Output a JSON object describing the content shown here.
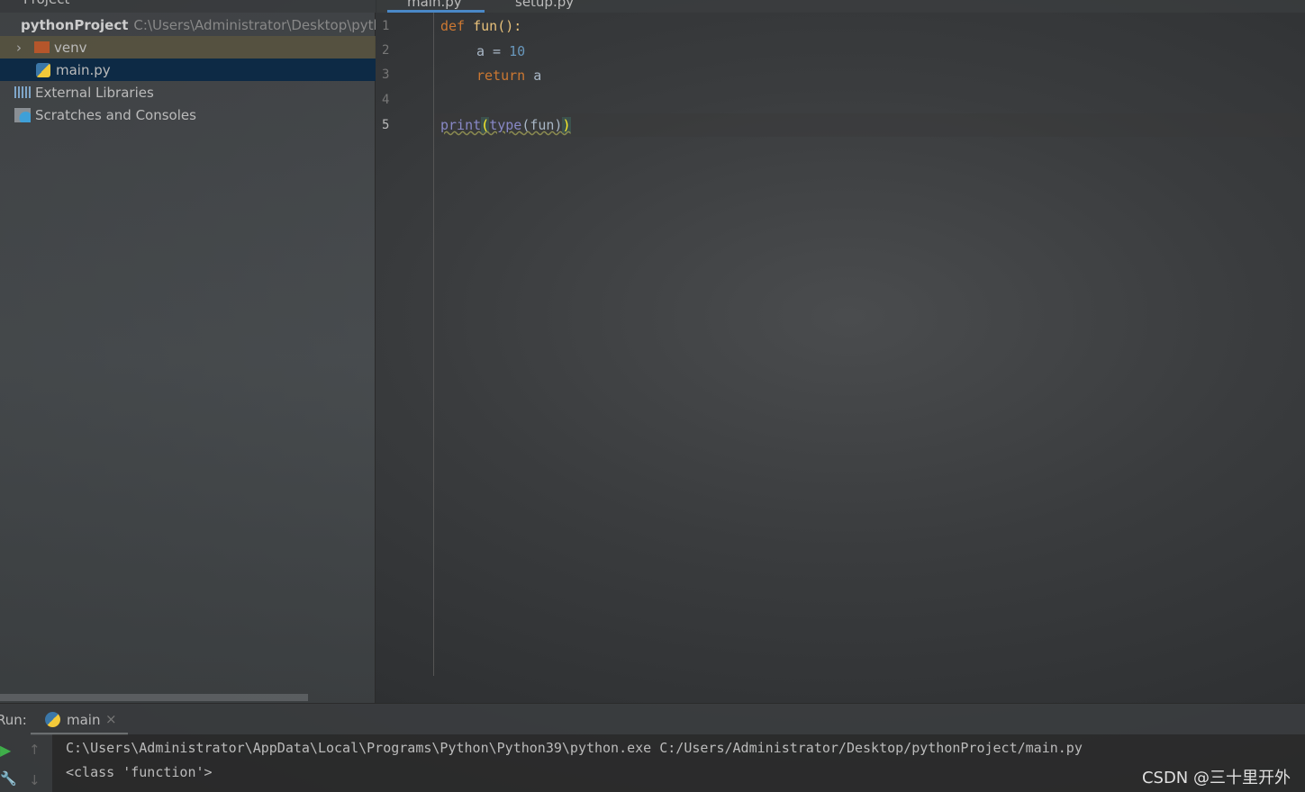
{
  "project_panel": {
    "title": "Project",
    "root": {
      "name": "pythonProject",
      "path": "C:\\Users\\Administrator\\Desktop\\pythonProject"
    },
    "items": [
      {
        "label": "venv"
      },
      {
        "label": "main.py"
      },
      {
        "label": "External Libraries"
      },
      {
        "label": "Scratches and Consoles"
      }
    ]
  },
  "editor": {
    "tabs": [
      {
        "label": "main.py",
        "active": true
      },
      {
        "label": "setup.py",
        "active": false
      }
    ],
    "line_numbers": [
      "1",
      "2",
      "3",
      "4",
      "5"
    ],
    "code": {
      "l1_kw": "def",
      "l1_rest": " fun():",
      "l2_a": "a = ",
      "l2_num": "10",
      "l3_kw": "return",
      "l3_rest": " a",
      "l5_print": "print",
      "l5_p1": "(",
      "l5_type": "type",
      "l5_mid": "(fun)",
      "l5_p2": ")"
    }
  },
  "run": {
    "label": "Run:",
    "tab": "main",
    "output": [
      "C:\\Users\\Administrator\\AppData\\Local\\Programs\\Python\\Python39\\python.exe C:/Users/Administrator/Desktop/pythonProject/main.py",
      "<class 'function'>"
    ]
  },
  "watermark": "CSDN @三十里开外"
}
